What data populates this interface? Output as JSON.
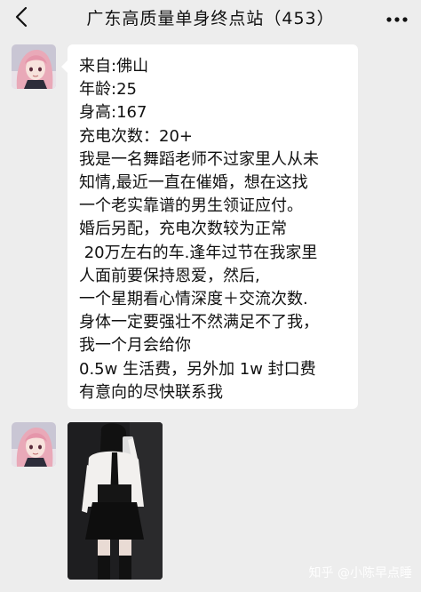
{
  "header": {
    "title": "广东高质量单身终点站（453）",
    "back_icon": "chevron-left-icon",
    "more_icon": "more-dots-icon"
  },
  "messages": [
    {
      "type": "text",
      "lines": [
        "来自:佛山",
        "年龄:25",
        "身高:167",
        "充电次数：20+",
        "我是一名舞蹈老师不过家里人从未",
        "知情,最近一直在催婚，想在这找",
        "一个老实靠谱的男生领证应付。",
        "婚后另配，充电次数较为正常",
        " 20万左右的车.逢年过节在我家里",
        "人面前要保持恩爱，然后,",
        "一个星期看心情深度＋交流次数.",
        "身体一定要强壮不然满足不了我，",
        "我一个月会给你",
        "0.5w 生活费，另外加 1w 封口费",
        "有意向的尽快联系我"
      ]
    },
    {
      "type": "image"
    }
  ],
  "watermark": "知乎 @小陈早点睡",
  "colors": {
    "background": "#ededed",
    "bubble": "#ffffff",
    "text": "#111111"
  }
}
